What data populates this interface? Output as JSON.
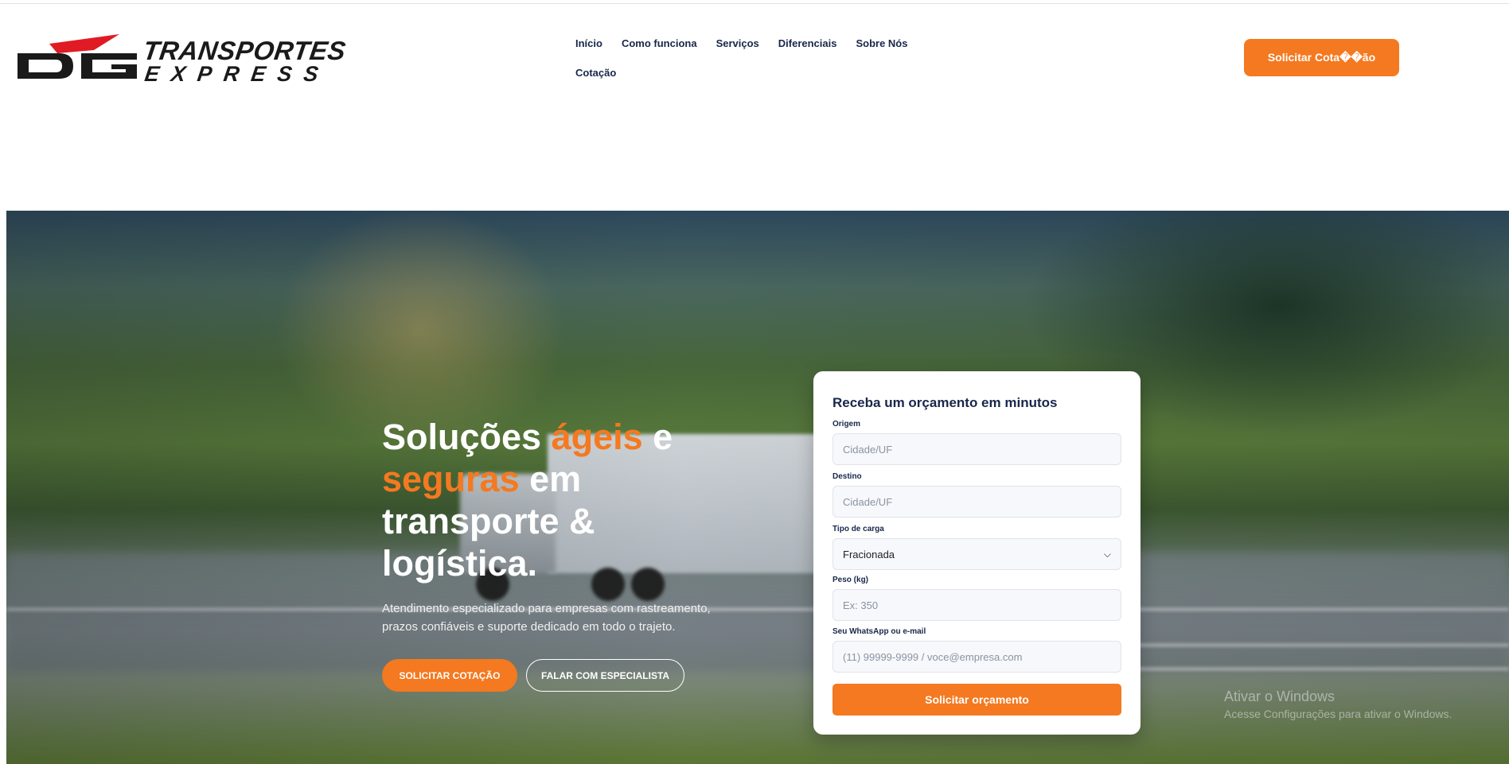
{
  "brand": {
    "mark": "DG",
    "line1": "TRANSPORTES",
    "line2": "EXPRESS",
    "colors": {
      "red": "#e01b24",
      "dark": "#1a1a1a"
    }
  },
  "nav": {
    "items": [
      {
        "label": "Início"
      },
      {
        "label": "Como funciona"
      },
      {
        "label": "Serviços"
      },
      {
        "label": "Diferenciais"
      },
      {
        "label": "Sobre Nós"
      },
      {
        "label": "Cotação"
      }
    ]
  },
  "header": {
    "cta_label": "Solicitar Cota��ão"
  },
  "hero": {
    "title_part1": "Soluções ",
    "title_accent1": "ágeis",
    "title_part2": " e ",
    "title_accent2": "seguras",
    "title_part3": " em transporte & logística.",
    "subtitle": "Atendimento especializado para empresas com rastreamento, prazos confiáveis e suporte dedicado em todo o trajeto.",
    "primary_button": "SOLICITAR COTAÇÃO",
    "secondary_button": "FALAR COM ESPECIALISTA"
  },
  "quote_form": {
    "title": "Receba um orçamento em minutos",
    "origin": {
      "label": "Origem",
      "placeholder": "Cidade/UF"
    },
    "destination": {
      "label": "Destino",
      "placeholder": "Cidade/UF"
    },
    "cargo_type": {
      "label": "Tipo de carga",
      "selected": "Fracionada"
    },
    "weight": {
      "label": "Peso (kg)",
      "placeholder": "Ex: 350"
    },
    "contact": {
      "label": "Seu WhatsApp ou e-mail",
      "placeholder": "(11) 99999-9999 / voce@empresa.com"
    },
    "submit_label": "Solicitar orçamento"
  },
  "windows_watermark": {
    "line1": "Ativar o Windows",
    "line2": "Acesse Configurações para ativar o Windows."
  },
  "colors": {
    "accent": "#f47920",
    "navy": "#17274a"
  }
}
